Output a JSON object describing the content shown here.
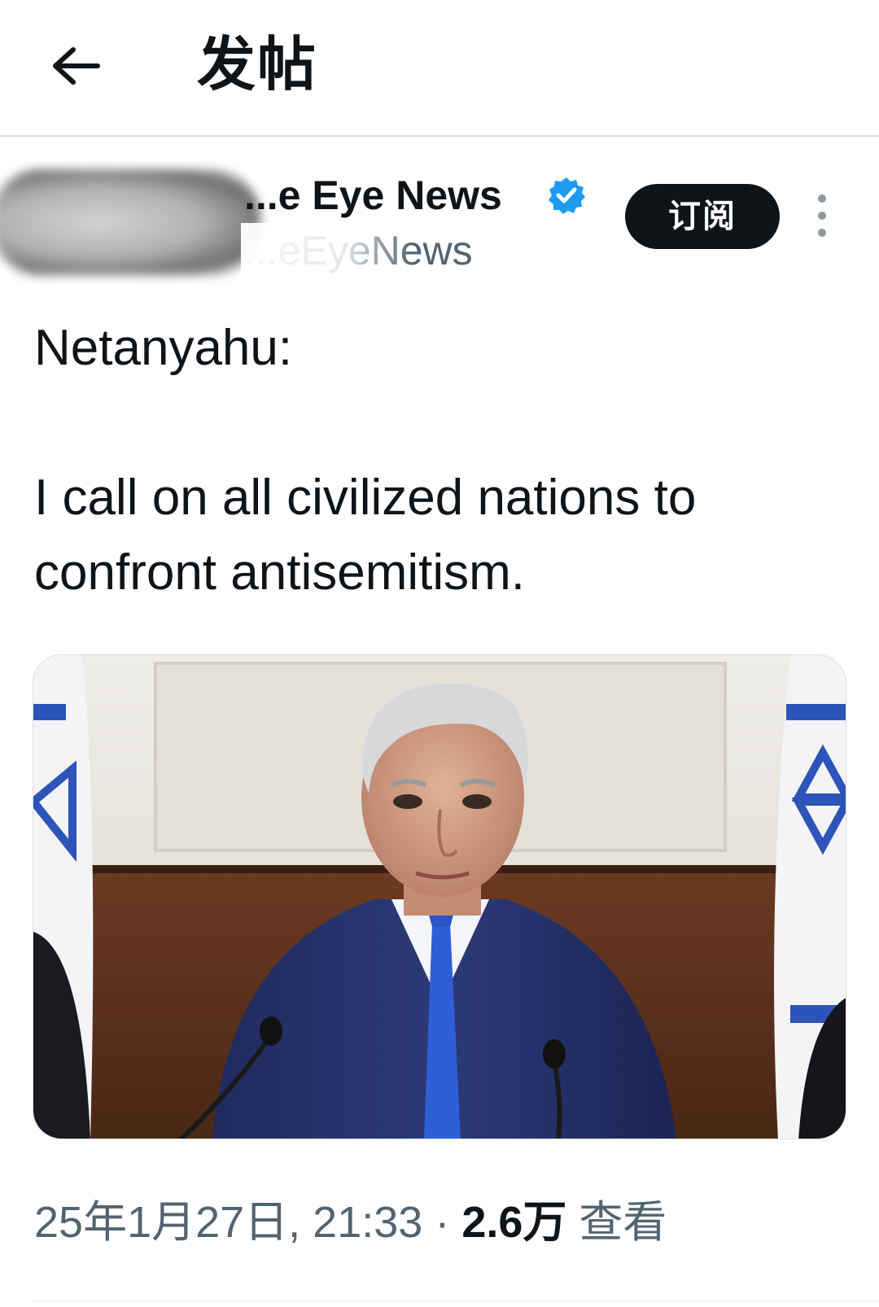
{
  "header": {
    "back_icon": "arrow-left-icon",
    "title": "发帖"
  },
  "author": {
    "display_name": "...e Eye News",
    "handle": "...eEyeNews",
    "verified": true,
    "verified_color": "#1d9bf0",
    "subscribe_label": "订阅",
    "more_icon": "more-vertical-icon"
  },
  "tweet": {
    "line1": "Netanyahu:",
    "line2": "I call on all civilized nations to confront antisemitism."
  },
  "media": {
    "kind": "photo"
  },
  "meta": {
    "timestamp": "25年1月27日, 21:33",
    "separator": "·",
    "views_count": "2.6万",
    "views_label": "查看"
  },
  "colors": {
    "text_primary": "#0f1419",
    "text_secondary": "#536471",
    "divider": "#d9dee3"
  }
}
